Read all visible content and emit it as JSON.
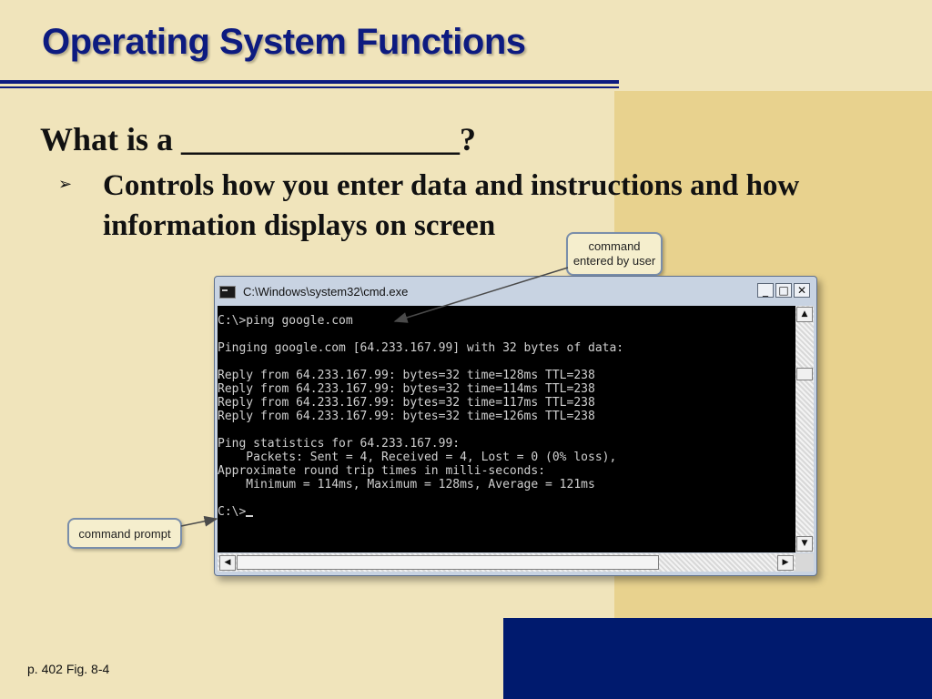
{
  "slide": {
    "title": "Operating System Functions",
    "question": "What is a _________________?",
    "bullet_marker": "➢",
    "bullet_text": "Controls how you enter data and instructions and how information displays on screen",
    "page_ref": "p. 402 Fig. 8-4"
  },
  "callouts": {
    "command": "command entered by user",
    "prompt": "command prompt"
  },
  "window": {
    "title": "C:\\Windows\\system32\\cmd.exe",
    "controls": {
      "minimize": "_",
      "maximize": "□",
      "close": "✕"
    },
    "scroll": {
      "up": "▲",
      "down": "▼",
      "left": "◀",
      "right": "▶"
    }
  },
  "console": {
    "lines": [
      "C:\\>ping google.com",
      "",
      "Pinging google.com [64.233.167.99] with 32 bytes of data:",
      "",
      "Reply from 64.233.167.99: bytes=32 time=128ms TTL=238",
      "Reply from 64.233.167.99: bytes=32 time=114ms TTL=238",
      "Reply from 64.233.167.99: bytes=32 time=117ms TTL=238",
      "Reply from 64.233.167.99: bytes=32 time=126ms TTL=238",
      "",
      "Ping statistics for 64.233.167.99:",
      "    Packets: Sent = 4, Received = 4, Lost = 0 (0% loss),",
      "Approximate round trip times in milli-seconds:",
      "    Minimum = 114ms, Maximum = 128ms, Average = 121ms",
      ""
    ],
    "prompt": "C:\\>"
  },
  "colors": {
    "background": "#f0e4bb",
    "accent_panel": "#e8d28e",
    "title": "#0d1b80",
    "corner_block": "#001a6e",
    "console_bg": "#000000",
    "console_text": "#d0d0d0"
  }
}
